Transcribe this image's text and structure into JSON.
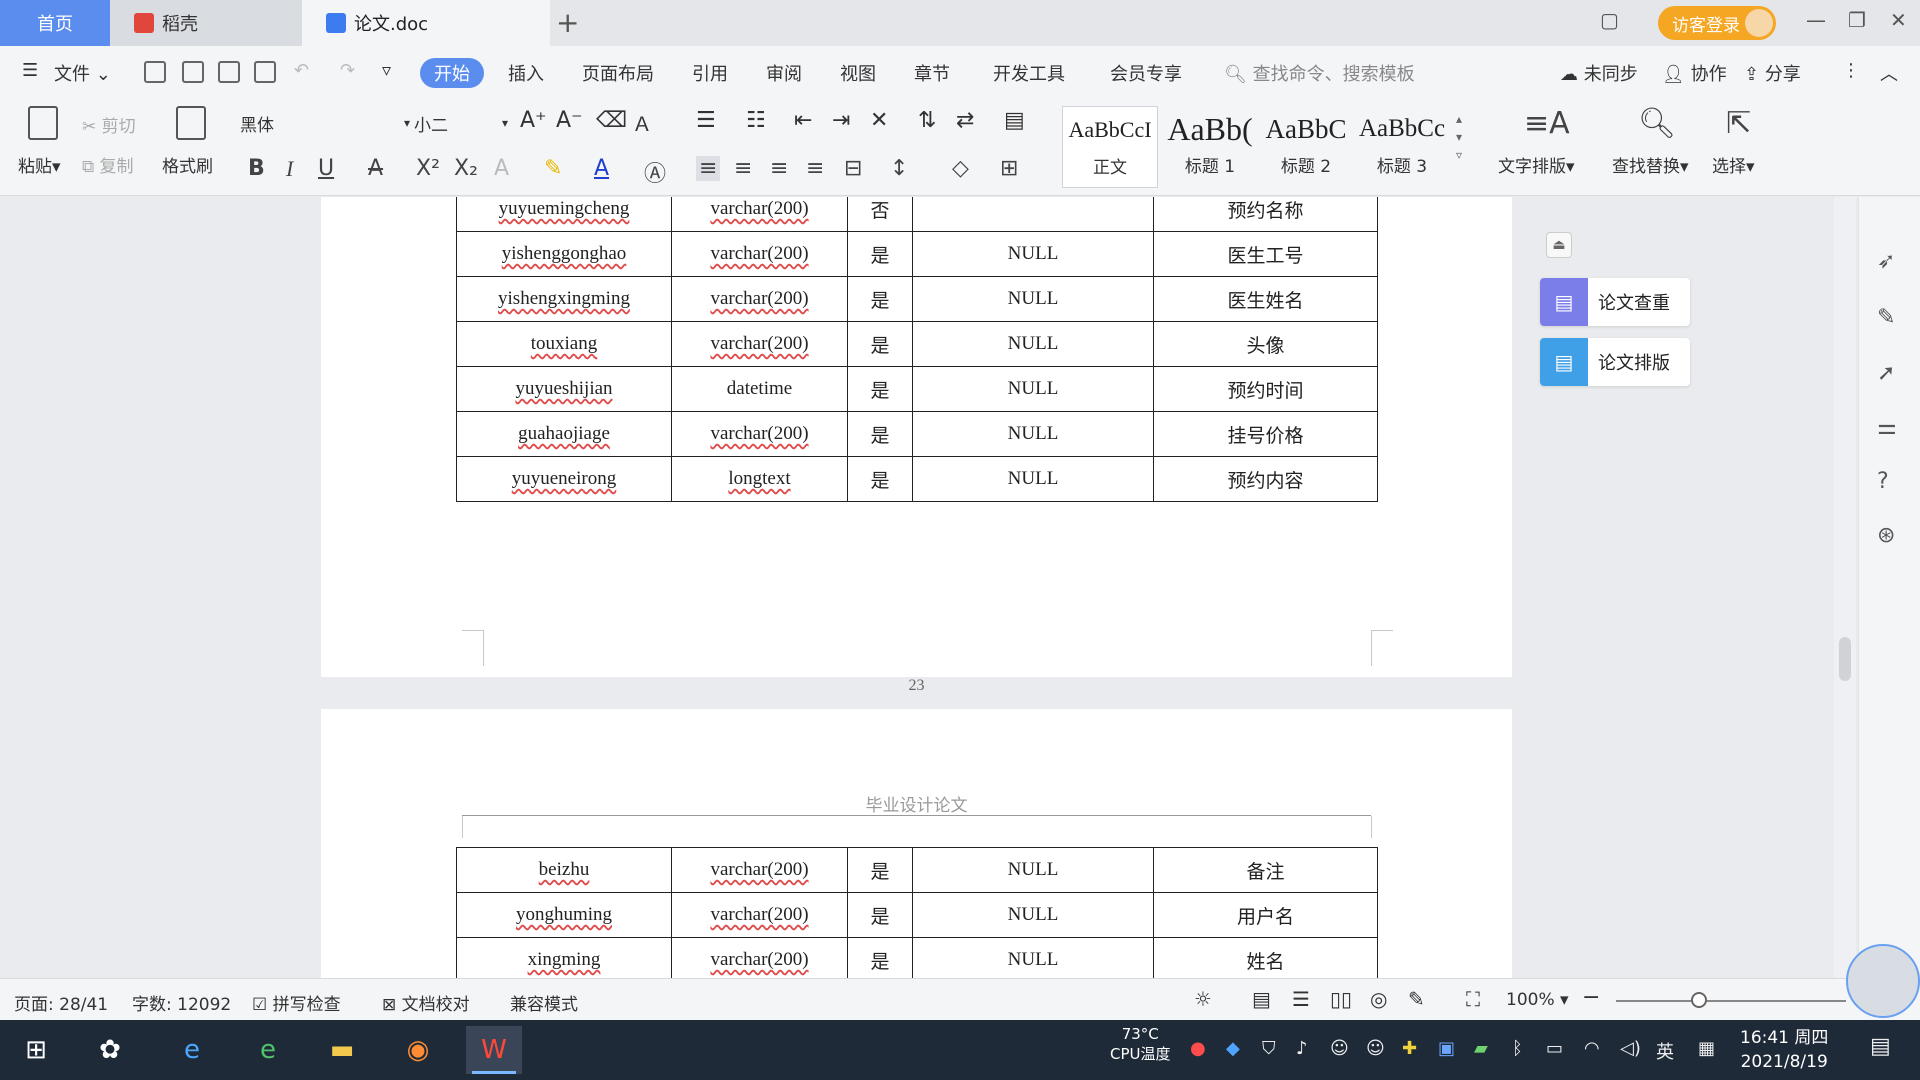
{
  "tabs": {
    "home": "首页",
    "daoke": "稻壳",
    "doc": "论文.doc"
  },
  "title_bar": {
    "login": "访客登录"
  },
  "menu": {
    "file": "文件",
    "start": "开始",
    "items": [
      "插入",
      "页面布局",
      "引用",
      "审阅",
      "视图",
      "章节",
      "开发工具",
      "会员专享"
    ],
    "search_placeholder": "查找命令、搜索模板",
    "unsynced": "未同步",
    "collab": "协作",
    "share": "分享"
  },
  "ribbon": {
    "paste": "粘贴",
    "cut": "剪切",
    "copy": "复制",
    "format_painter": "格式刷",
    "font_name": "黑体",
    "font_size": "小二",
    "styles": [
      {
        "sample": "AaBbCcI",
        "name": "正文"
      },
      {
        "sample": "AaBb(",
        "name": "标题 1"
      },
      {
        "sample": "AaBbC",
        "name": "标题 2"
      },
      {
        "sample": "AaBbCc",
        "name": "标题 3"
      }
    ],
    "text_layout": "文字排版",
    "find_replace": "查找替换",
    "select": "选择"
  },
  "document": {
    "page1_rows": [
      [
        "yuyuemingcheng",
        "varchar(200)",
        "否",
        "",
        "预约名称"
      ],
      [
        "yishenggonghao",
        "varchar(200)",
        "是",
        "NULL",
        "医生工号"
      ],
      [
        "yishengxingming",
        "varchar(200)",
        "是",
        "NULL",
        "医生姓名"
      ],
      [
        "touxiang",
        "varchar(200)",
        "是",
        "NULL",
        "头像"
      ],
      [
        "yuyueshijian",
        "datetime",
        "是",
        "NULL",
        "预约时间"
      ],
      [
        "guahaojiage",
        "varchar(200)",
        "是",
        "NULL",
        "挂号价格"
      ],
      [
        "yuyueneirong",
        "longtext",
        "是",
        "NULL",
        "预约内容"
      ]
    ],
    "page_number": "23",
    "page2_header": "毕业设计论文",
    "page2_rows": [
      [
        "beizhu",
        "varchar(200)",
        "是",
        "NULL",
        "备注"
      ],
      [
        "yonghuming",
        "varchar(200)",
        "是",
        "NULL",
        "用户名"
      ],
      [
        "xingming",
        "varchar(200)",
        "是",
        "NULL",
        "姓名"
      ]
    ]
  },
  "side_panel": {
    "check": "论文查重",
    "layout": "论文排版"
  },
  "status": {
    "page": "页面: 28/41",
    "words": "字数: 12092",
    "spell": "拼写检查",
    "proof": "文档校对",
    "compat": "兼容模式",
    "zoom": "100%",
    "zoom_fraction": 0.36
  },
  "taskbar": {
    "temp": "73°C",
    "temp_label": "CPU温度",
    "ime": "英",
    "time": "16:41 周四",
    "date": "2021/8/19"
  },
  "colors": {
    "accent": "#5b8def",
    "login": "#f5a623"
  }
}
